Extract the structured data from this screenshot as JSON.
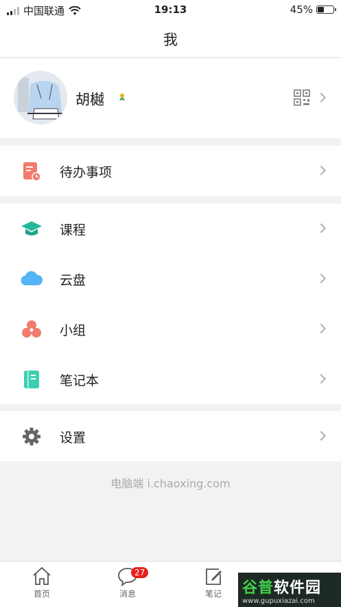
{
  "status_bar": {
    "carrier": "中国联通",
    "time": "19:13",
    "battery": "45%",
    "battery_level": 0.45
  },
  "nav": {
    "title": "我"
  },
  "profile": {
    "name": "胡樾"
  },
  "menu": {
    "todo": "待办事项",
    "courses": "课程",
    "cloud": "云盘",
    "group": "小组",
    "notebook": "笔记本",
    "settings": "设置"
  },
  "footer": {
    "text": "电脑端 i.chaoxing.com"
  },
  "tabbar": {
    "home": "首页",
    "messages": "消息",
    "messages_badge": "27",
    "notes": "笔记"
  },
  "watermark": {
    "line1a": "谷普",
    "line1b": "软件园",
    "line2": "www.gupuxiazai.com"
  },
  "colors": {
    "todo": "#f07b6e",
    "course": "#23b89a",
    "cloud": "#53b5f5",
    "group": "#f07b6e",
    "notebook": "#3ecfb1",
    "settings": "#666666",
    "badge": "#e8201c"
  }
}
